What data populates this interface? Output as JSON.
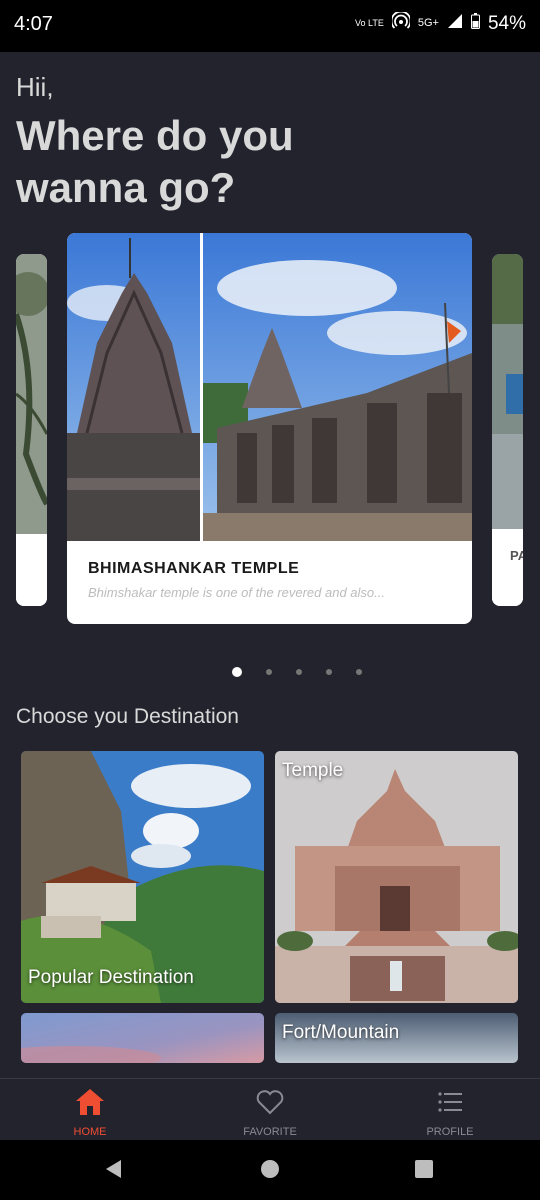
{
  "status": {
    "time": "4:07",
    "volte": "Vo LTE",
    "network": "5G+",
    "battery": "54%"
  },
  "greeting": "Hii,",
  "headline": "Where do you wanna go?",
  "carousel": {
    "main": {
      "title": "BHIMASHANKAR TEMPLE",
      "description": "Bhimshakar temple is one of the revered and also..."
    },
    "next_title": "PA",
    "pages": 5,
    "active_page": 1
  },
  "section_title": "Choose you Destination",
  "categories": [
    {
      "label": "Popular Destination"
    },
    {
      "label": "Temple"
    },
    {
      "label": ""
    },
    {
      "label": "Fort/Mountain"
    }
  ],
  "nav": {
    "items": [
      {
        "label": "HOME",
        "icon": "home-icon"
      },
      {
        "label": "FAVORITE",
        "icon": "heart-icon"
      },
      {
        "label": "PROFILE",
        "icon": "list-icon"
      }
    ],
    "active_color": "#f04e32"
  }
}
